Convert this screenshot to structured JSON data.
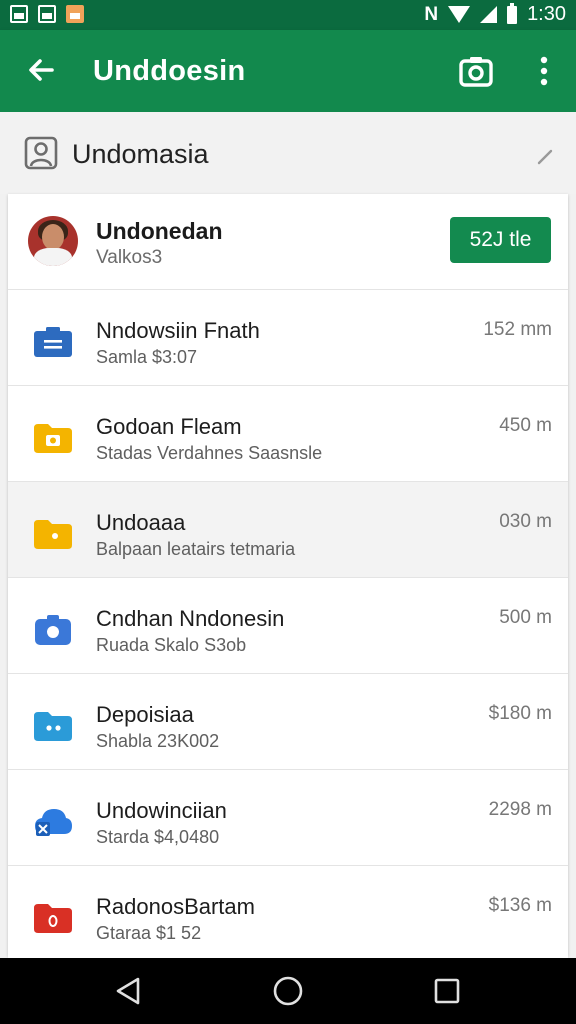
{
  "status_bar": {
    "time": "1:30",
    "left_icons": [
      "gallery-icon",
      "gallery-icon",
      "photo-icon"
    ],
    "right_icons": [
      "nfc-icon",
      "wifi-icon",
      "signal-icon",
      "battery-icon"
    ],
    "nfc_label": "N"
  },
  "app_bar": {
    "title": "Unddoesin",
    "color": "#12894d",
    "status_color": "#0b6b3f"
  },
  "account": {
    "title": "Undomasia"
  },
  "user": {
    "name": "Undonedan",
    "subtitle": "Valkos3",
    "storage_button": "52J tle"
  },
  "files": [
    {
      "title": "Nndowsiin Fnath",
      "subtitle": "Samla $3:07",
      "size": "152 mm",
      "icon": "briefcase-icon",
      "icon_color": "#2d6bbf"
    },
    {
      "title": "Godoan Fleam",
      "subtitle": "Stadas Verdahnes Saasnsle",
      "size": "450 m",
      "icon": "camera-folder-icon",
      "icon_color": "#f4b400"
    },
    {
      "title": "Undoaaa",
      "subtitle": "Balpaan leatairs tetmaria",
      "size": "030 m",
      "icon": "folder-icon",
      "icon_color": "#f4b400"
    },
    {
      "title": "Cndhan Nndonesin",
      "subtitle": "Ruada Skalo S3ob",
      "size": "500 m",
      "icon": "camera-icon",
      "icon_color": "#3b78d8"
    },
    {
      "title": "Depoisiaa",
      "subtitle": "Shabla 23K002",
      "size": "$180 m",
      "icon": "shared-folder-icon",
      "icon_color": "#2b9bd8"
    },
    {
      "title": "Undowinciian",
      "subtitle": "Starda $4,0480",
      "size": "2298 m",
      "icon": "cloud-upload-icon",
      "icon_color": "#2d7be0"
    },
    {
      "title": "RadonosBartam",
      "subtitle": "Gtaraa $1 52",
      "size": "$136 m",
      "icon": "pdf-icon",
      "icon_color": "#d93025"
    }
  ],
  "nav_bar": {
    "buttons": [
      "back-nav-icon",
      "home-nav-icon",
      "recents-nav-icon"
    ]
  }
}
